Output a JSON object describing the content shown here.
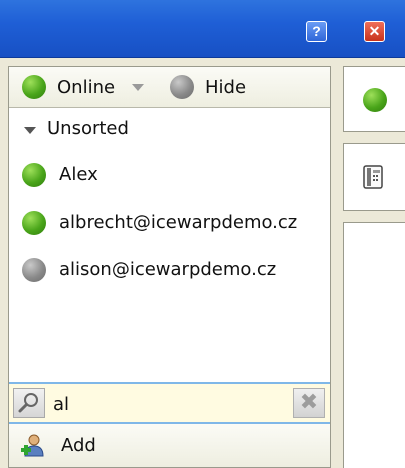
{
  "window": {
    "help_label": "?",
    "close_label": "✕"
  },
  "status_bar": {
    "status_label": "Online",
    "status_color": "#4aa51a",
    "hide_label": "Hide",
    "hide_color": "#8a8a8a"
  },
  "contacts": {
    "group_label": "Unsorted",
    "items": [
      {
        "name": "Alex",
        "status": "online"
      },
      {
        "name": "albrecht@icewarpdemo.cz",
        "status": "online"
      },
      {
        "name": "alison@icewarpdemo.cz",
        "status": "offline"
      }
    ]
  },
  "search": {
    "value": "al",
    "clear_label": "✖"
  },
  "add": {
    "label": "Add"
  }
}
